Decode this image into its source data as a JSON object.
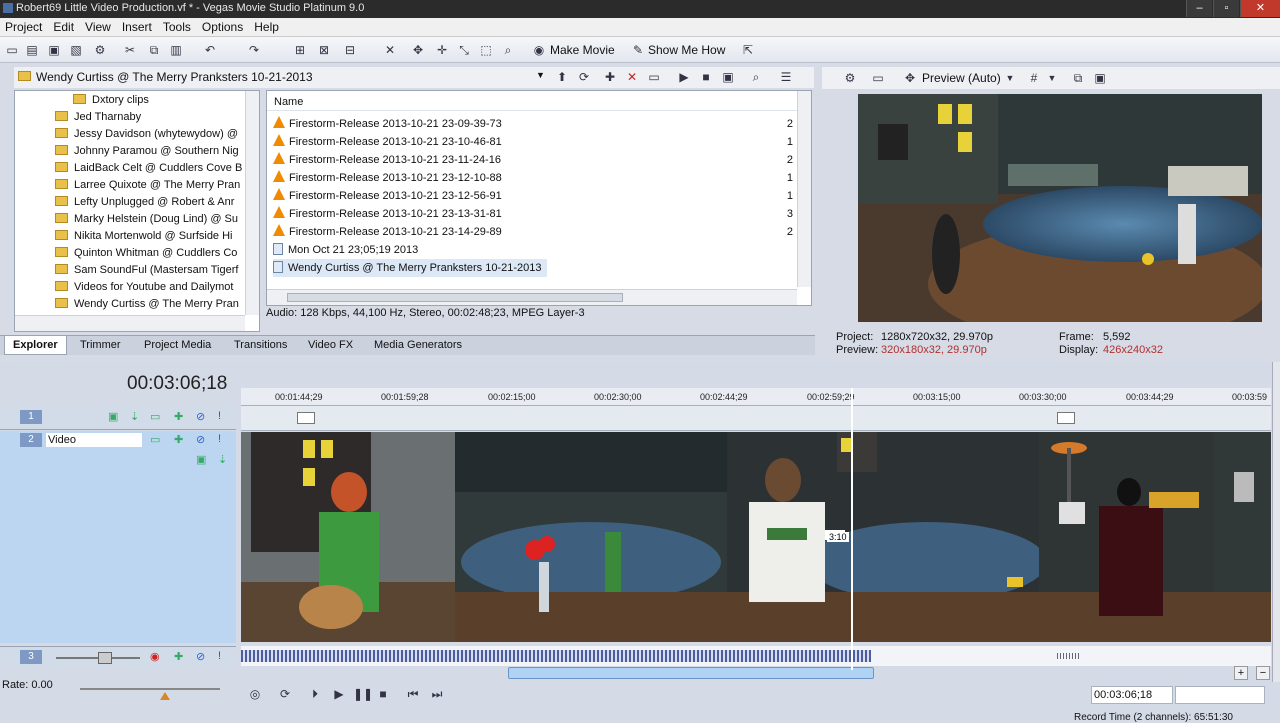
{
  "window": {
    "title": "Robert69 Little Video Production.vf * - Vegas Movie Studio Platinum 9.0",
    "controls": [
      "–",
      "▫",
      "✕"
    ]
  },
  "menu": [
    "Project",
    "Edit",
    "View",
    "Insert",
    "Tools",
    "Options",
    "Help"
  ],
  "toolbar": {
    "make_movie": "Make Movie",
    "show_me_how": "Show Me How"
  },
  "explorer": {
    "path": "Wendy Curtiss @ The Merry Pranksters 10-21-2013",
    "tree": [
      "Dxtory clips",
      "Jed Tharnaby",
      "Jessy Davidson (whytewydow) @",
      "Johnny Paramou @ Southern Nig",
      "LaidBack Celt @ Cuddlers Cove B",
      "Larree Quixote @ The Merry Pran",
      "Lefty Unplugged @ Robert & Anr",
      "Marky Helstein (Doug Lind) @ Su",
      "Nikita Mortenwold @ Surfside Hi",
      "Quinton Whitman @ Cuddlers Co",
      "Sam SoundFul (Mastersam Tigerf",
      "Videos for Youtube and Dailymot",
      "Wendy Curtiss @ The Merry Pran"
    ],
    "column_name": "Name",
    "files": [
      {
        "name": "Firestorm-Release 2013-10-21 23-09-39-73",
        "num": "2",
        "type": "vlc"
      },
      {
        "name": "Firestorm-Release 2013-10-21 23-10-46-81",
        "num": "1",
        "type": "vlc"
      },
      {
        "name": "Firestorm-Release 2013-10-21 23-11-24-16",
        "num": "2",
        "type": "vlc"
      },
      {
        "name": "Firestorm-Release 2013-10-21 23-12-10-88",
        "num": "1",
        "type": "vlc"
      },
      {
        "name": "Firestorm-Release 2013-10-21 23-12-56-91",
        "num": "1",
        "type": "vlc"
      },
      {
        "name": "Firestorm-Release 2013-10-21 23-13-31-81",
        "num": "3",
        "type": "vlc"
      },
      {
        "name": "Firestorm-Release 2013-10-21 23-14-29-89",
        "num": "2",
        "type": "vlc"
      },
      {
        "name": "Mon Oct 21 23;05;19 2013",
        "num": "",
        "type": "media"
      },
      {
        "name": "Wendy Curtiss @ The Merry Pranksters 10-21-2013",
        "num": "",
        "type": "media"
      }
    ],
    "info": "Audio: 128 Kbps, 44,100 Hz, Stereo, 00:02:48;23, MPEG Layer-3",
    "tabs": [
      "Explorer",
      "Trimmer",
      "Project Media",
      "Transitions",
      "Video FX",
      "Media Generators"
    ]
  },
  "preview": {
    "mode": "Preview (Auto)",
    "project_label": "Project:",
    "project_value": "1280x720x32, 29.970p",
    "preview_label": "Preview:",
    "preview_value": "320x180x32, 29.970p",
    "frame_label": "Frame:",
    "frame_value": "5,592",
    "display_label": "Display:",
    "display_value": "426x240x32"
  },
  "timeline": {
    "timecode": "00:03:06;18",
    "ruler": [
      "00:01:44;29",
      "00:01:59;28",
      "00:02:15;00",
      "00:02:30;00",
      "00:02:44;29",
      "00:02:59;29",
      "00:03:15;00",
      "00:03:30;00",
      "00:03:44;29",
      "00:03:59"
    ],
    "tracks": [
      {
        "num": "1",
        "name": ""
      },
      {
        "num": "2",
        "name": "Video"
      },
      {
        "num": "3",
        "name": ""
      }
    ],
    "rate": "Rate: 0.00",
    "clip_label": "3:10",
    "cursor_time": "00:03:06;18",
    "record_time": "Record Time (2 channels): 65:51:30"
  }
}
